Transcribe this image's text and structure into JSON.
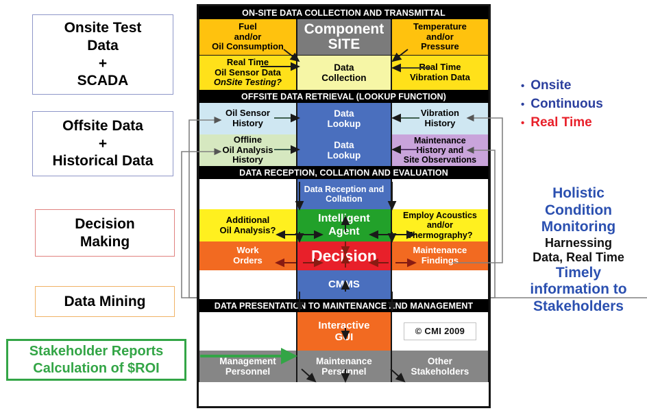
{
  "left_labels": [
    {
      "id": "onsite-test-data",
      "text": "Onsite Test\nData\n+\nSCADA",
      "border": "#8e96c8"
    },
    {
      "id": "offsite-data",
      "text": "Offsite Data\n+\nHistorical Data",
      "border": "#8e96c8"
    },
    {
      "id": "decision-making",
      "text": "Decision\nMaking",
      "border": "#e0817f"
    },
    {
      "id": "data-mining",
      "text": "Data Mining",
      "border": "#f0b265"
    },
    {
      "id": "stakeholder-reports",
      "text": "Stakeholder Reports\nCalculation of $ROI",
      "border": "#33a546"
    }
  ],
  "right_bullets": {
    "items": [
      {
        "label": "Onsite",
        "color": "#2b3f9e"
      },
      {
        "label": "Continuous",
        "color": "#2b3f9e"
      },
      {
        "label": "Real Time",
        "color": "#e8202a"
      }
    ]
  },
  "right_text": {
    "line1": "Holistic",
    "line2": "Condition",
    "line3": "Monitoring",
    "line4": "Harnessing",
    "line5": "Data, Real Time",
    "line6": "Timely",
    "line7": "information to",
    "line8": "Stakeholders"
  },
  "diagram": {
    "bands": {
      "onsite": "ON-SITE DATA COLLECTION AND TRANSMITTAL",
      "offsite": "OFFSITE DATA RETRIEVAL (LOOKUP FUNCTION)",
      "reception": "DATA RECEPTION, COLLATION AND EVALUATION",
      "presentation": "DATA PRESENTATION TO MAINTENANCE AND MANAGEMENT"
    },
    "r1": {
      "left": "Fuel\nand/or\nOil Consumption",
      "mid": "Component\nSITE",
      "right": "Temperature\nand/or\nPressure"
    },
    "r2": {
      "left_l1": "Real Time",
      "left_l2": "Oil Sensor Data",
      "left_l3": "OnSite Testing?",
      "mid": "Data\nCollection",
      "right": "Real Time\nVibration Data"
    },
    "r3": {
      "left": "Oil Sensor\nHistory",
      "mid": "Data\nLookup",
      "right": "Vibration\nHistory"
    },
    "r4": {
      "left": "Offline\nOil Analysis\nHistory",
      "mid": "Data\nLookup",
      "right": "Maintenance\nHistory and\nSite Observations"
    },
    "r5": {
      "left": "",
      "mid": "Data Reception and\nCollation",
      "right": ""
    },
    "r6": {
      "left": "Additional\nOil Analysis?",
      "mid": "Intelligent\nAgent",
      "right": "Employ Acoustics\nand/or\nThermography?"
    },
    "r7": {
      "left": "Work\nOrders",
      "mid": "Decision",
      "right": "Maintenance\nFindings"
    },
    "r8": {
      "left": "",
      "mid": "CMMS",
      "right": ""
    },
    "r9": {
      "left": "",
      "mid": "Interactive\nGUI",
      "right": "© CMI 2009"
    },
    "r10": {
      "left": "Management\nPersonnel",
      "mid": "Maintenance\nPersonnel",
      "right": "Other\nStakeholders"
    }
  },
  "colors": {
    "band_bg": "#000000",
    "gold": "#FFC20E",
    "yellow_bright": "#FFE11A",
    "pale_yellow": "#F6F6A6",
    "gray_site": "#7B7B7B",
    "light_blue": "#CFE7F2",
    "blue": "#4A6FBE",
    "light_green": "#D6E8C0",
    "purple": "#C9A4DB",
    "yellow": "#FFF01F",
    "green": "#22A12A",
    "red": "#E8202A",
    "orange": "#F26A21",
    "gray_personnel": "#868686",
    "white": "#FFFFFF",
    "connector": "#808080",
    "green_arrow": "#33A546"
  }
}
